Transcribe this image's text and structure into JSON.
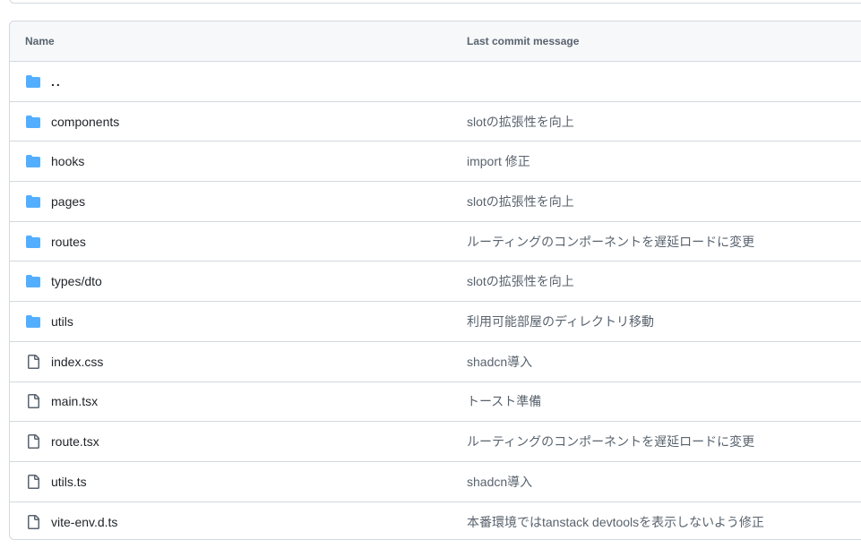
{
  "table": {
    "headers": {
      "name": "Name",
      "last_commit_message": "Last commit message"
    },
    "parent_dir": {
      "label": "..",
      "icon": "folder-icon"
    },
    "rows": [
      {
        "type": "folder",
        "icon": "folder-icon",
        "name": "components",
        "message": "slotの拡張性を向上"
      },
      {
        "type": "folder",
        "icon": "folder-icon",
        "name": "hooks",
        "message": "import 修正"
      },
      {
        "type": "folder",
        "icon": "folder-icon",
        "name": "pages",
        "message": "slotの拡張性を向上"
      },
      {
        "type": "folder",
        "icon": "folder-icon",
        "name": "routes",
        "message": "ルーティングのコンポーネントを遅延ロードに変更"
      },
      {
        "type": "folder",
        "icon": "folder-icon",
        "name": "types/dto",
        "message": "slotの拡張性を向上"
      },
      {
        "type": "folder",
        "icon": "folder-icon",
        "name": "utils",
        "message": "利用可能部屋のディレクトリ移動"
      },
      {
        "type": "file",
        "icon": "file-icon",
        "name": "index.css",
        "message": "shadcn導入"
      },
      {
        "type": "file",
        "icon": "file-icon",
        "name": "main.tsx",
        "message": "トースト準備"
      },
      {
        "type": "file",
        "icon": "file-icon",
        "name": "route.tsx",
        "message": "ルーティングのコンポーネントを遅延ロードに変更"
      },
      {
        "type": "file",
        "icon": "file-icon",
        "name": "utils.ts",
        "message": "shadcn導入"
      },
      {
        "type": "file",
        "icon": "file-icon",
        "name": "vite-env.d.ts",
        "message": "本番環境ではtanstack devtoolsを表示しないよう修正"
      }
    ]
  },
  "colors": {
    "folder": "#54aeff",
    "file": "#59636e",
    "border": "#d1d9e0",
    "header_bg": "#f6f8fa"
  }
}
